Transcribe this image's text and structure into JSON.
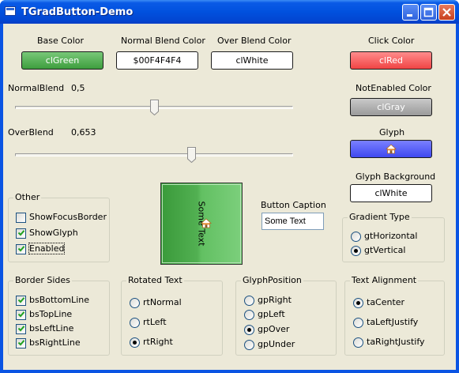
{
  "window": {
    "title": "TGradButton-Demo"
  },
  "colors": {
    "base_color_label": "Base Color",
    "base_color_value": "clGreen",
    "normal_blend_label": "Normal Blend Color",
    "normal_blend_value": "$00F4F4F4",
    "over_blend_label": "Over Blend Color",
    "over_blend_value": "clWhite",
    "click_color_label": "Click Color",
    "click_color_value": "clRed",
    "not_enabled_label": "NotEnabled Color",
    "not_enabled_value": "clGray",
    "glyph_label": "Glyph",
    "glyph_background_label": "Glyph Background",
    "glyph_background_value": "clWhite"
  },
  "sliders": {
    "normal_blend_label": "NormalBlend",
    "normal_blend_value": "0,5",
    "over_blend_label": "OverBlend",
    "over_blend_value": "0,653",
    "normal_blend_fraction": 0.5,
    "over_blend_fraction": 0.653
  },
  "demo_button": {
    "caption": "Some Text",
    "glyph_icon": "home-icon"
  },
  "button_caption": {
    "label": "Button Caption",
    "value": "Some Text"
  },
  "other": {
    "title": "Other",
    "items": [
      {
        "label": "ShowFocusBorder",
        "checked": false
      },
      {
        "label": "ShowGlyph",
        "checked": true
      },
      {
        "label": "Enabled",
        "checked": true
      }
    ]
  },
  "gradient_type": {
    "title": "Gradient Type",
    "options": [
      {
        "label": "gtHorizontal",
        "selected": false
      },
      {
        "label": "gtVertical",
        "selected": true
      }
    ]
  },
  "border_sides": {
    "title": "Border Sides",
    "items": [
      {
        "label": "bsBottomLine",
        "checked": true
      },
      {
        "label": "bsTopLine",
        "checked": true
      },
      {
        "label": "bsLeftLine",
        "checked": true
      },
      {
        "label": "bsRightLine",
        "checked": true
      }
    ]
  },
  "rotated_text": {
    "title": "Rotated Text",
    "options": [
      {
        "label": "rtNormal",
        "selected": false
      },
      {
        "label": "rtLeft",
        "selected": false
      },
      {
        "label": "rtRight",
        "selected": true
      }
    ]
  },
  "glyph_position": {
    "title": "GlyphPosition",
    "options": [
      {
        "label": "gpRight",
        "selected": false
      },
      {
        "label": "gpLeft",
        "selected": false
      },
      {
        "label": "gpOver",
        "selected": true
      },
      {
        "label": "gpUnder",
        "selected": false
      }
    ]
  },
  "text_alignment": {
    "title": "Text Alignment",
    "options": [
      {
        "label": "taCenter",
        "selected": true
      },
      {
        "label": "taLeftJustify",
        "selected": false
      },
      {
        "label": "taRightJustify",
        "selected": false
      }
    ]
  }
}
